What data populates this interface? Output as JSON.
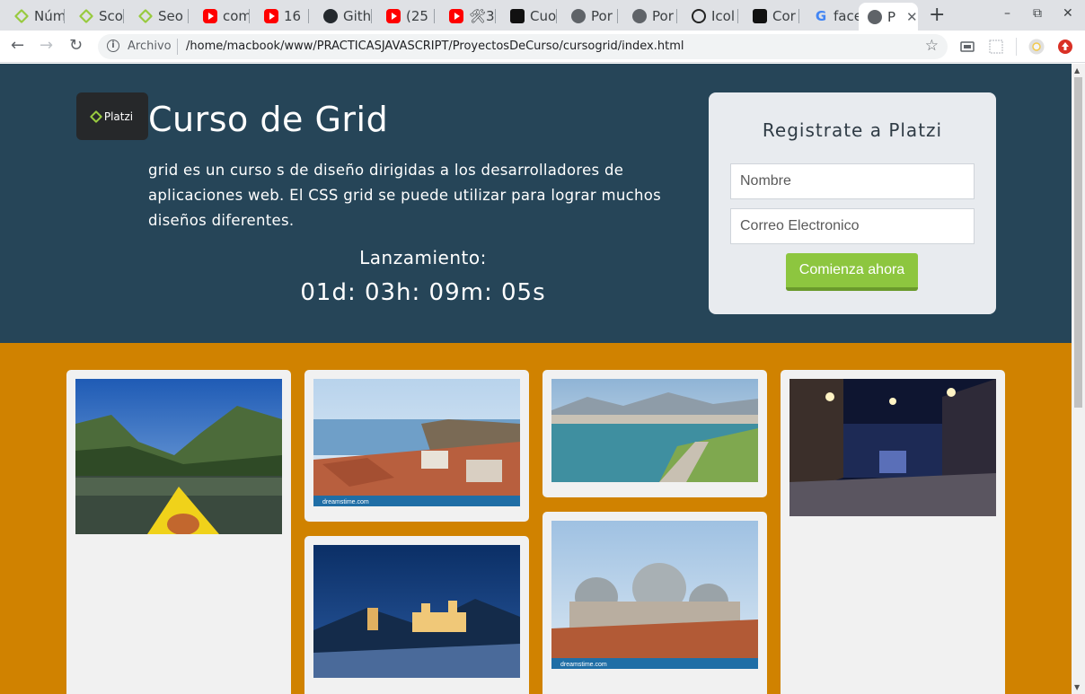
{
  "browser": {
    "tabs": [
      {
        "icon": "platzi-icon",
        "title": "Núm"
      },
      {
        "icon": "platzi-icon",
        "title": "Sco"
      },
      {
        "icon": "platzi-icon",
        "title": "Seo"
      },
      {
        "icon": "youtube-icon",
        "title": "com"
      },
      {
        "icon": "youtube-icon",
        "title": "16"
      },
      {
        "icon": "github-icon",
        "title": "Gith"
      },
      {
        "icon": "youtube-icon",
        "title": "(25"
      },
      {
        "icon": "youtube-icon",
        "title": "🛠3"
      },
      {
        "icon": "codepen-icon",
        "title": "Cuo"
      },
      {
        "icon": "globe-icon",
        "title": "Por"
      },
      {
        "icon": "globe-icon",
        "title": "Por"
      },
      {
        "icon": "circle-icon",
        "title": "Icol"
      },
      {
        "icon": "codepen-icon",
        "title": "Cor"
      },
      {
        "icon": "google-icon",
        "title": "face"
      },
      {
        "icon": "globe-icon",
        "title": "P"
      }
    ],
    "active_tab_close": "✕",
    "new_tab": "+",
    "window_controls": {
      "minimize": "–",
      "restore": "⧉",
      "close": "✕"
    },
    "address": {
      "scheme_label": "Archivo",
      "url": "/home/macbook/www/PRACTICASJAVASCRIPT/ProyectosDeCurso/cursogrid/index.html"
    }
  },
  "page": {
    "logo_text": "Platzi",
    "title": "Curso de Grid",
    "description": "grid es un curso s de diseño dirigidas a los desarrolladores de aplicaciones web. El CSS grid se puede utilizar para lograr muchos diseños diferentes.",
    "launch_label": "Lanzamiento:",
    "countdown": "01d: 03h: 09m: 05s",
    "form": {
      "title": "Registrate a Platzi",
      "name_placeholder": "Nombre",
      "email_placeholder": "Correo Electronico",
      "submit_label": "Comienza ahora"
    },
    "colors": {
      "hero_bg": "#264558",
      "gallery_bg": "#d08200",
      "accent_green": "#8dc63f"
    },
    "gallery": [
      {
        "name": "kayak-river-photo",
        "watermark": ""
      },
      {
        "name": "coastal-town-photo",
        "watermark": "dreamstime.com"
      },
      {
        "name": "lake-park-photo",
        "watermark": ""
      },
      {
        "name": "night-plaza-photo",
        "watermark": ""
      },
      {
        "name": "castle-night-photo",
        "watermark": ""
      },
      {
        "name": "domes-rooftops-photo",
        "watermark": "dreamstime.com"
      }
    ]
  }
}
